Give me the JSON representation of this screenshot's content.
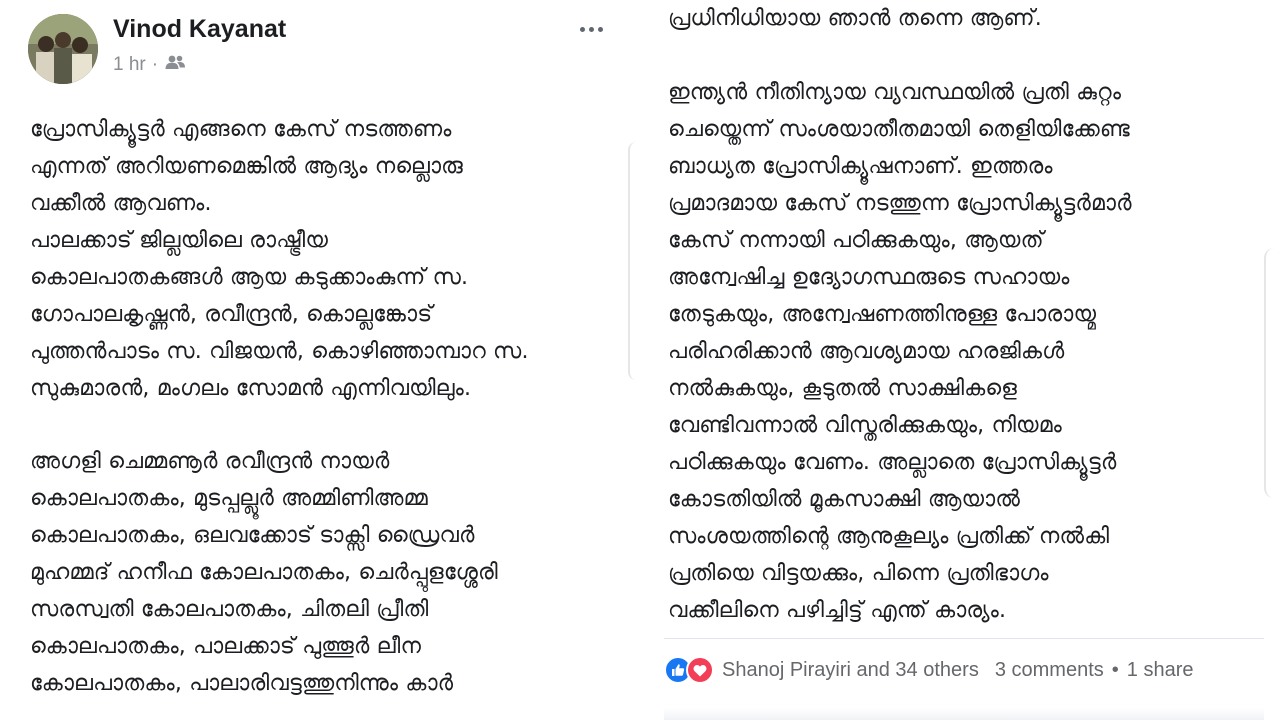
{
  "post": {
    "author": "Vinod Kayanat",
    "timestamp": "1 hr",
    "audience_icon": "friends-icon"
  },
  "left": {
    "para1": "പ്രോസിക്യൂട്ടർ എങ്ങനെ കേസ് നടത്തണം\nഎന്നത് അറിയണമെങ്കിൽ ആദ്യം നല്ലൊരു\nവക്കീൽ ആവണം.\nപാലക്കാട് ജില്ലയിലെ  രാഷ്ട്രീയ\nകൊലപാതകങ്ങൾ ആയ കടുക്കാംകുന്ന് സ.\nഗോപാലകൃഷ്ണൻ, രവീന്ദ്രൻ, കൊല്ലങ്കോട്\nപുത്തൻപാടം സ. വിജയൻ, കൊഴിഞ്ഞാമ്പാറ സ.\nസുകുമാരൻ, മംഗലം സോമൻ എന്നിവയിലും.",
    "para2": "അഗളി  ചെമ്മണൂർ രവീന്ദ്രൻ നായർ\nകൊലപാതകം,  മുടപ്പല്ലൂർ അമ്മിണിഅമ്മ\nകൊലപാതകം, ഒലവക്കോട് ടാക്സി ഡ്രൈവർ\nമുഹമ്മദ് ഹനീഫ കോലപാതകം,  ചെർപ്പുളശ്ശേരി\nസരസ്വതി കോലപാതകം,  ചിതലി പ്രീതി\nകൊലപാതകം, പാലക്കാട് പുത്തൂർ ലീന\nകോലപാതകം, പാലാരിവട്ടത്തുനിന്നും കാർ"
  },
  "right": {
    "para3": "പ്രധിനിധിയായ ഞാൻ തന്നെ ആണ്.",
    "para4": "ഇന്ത്യൻ നീതിന്യായ വ്യവസ്ഥയിൽ പ്രതി കുറ്റം\nചെയ്തെന്ന് സംശയാതീതമായി തെളിയിക്കേണ്ട\nബാധ്യത പ്രോസിക്യൂഷനാണ്. ഇത്തരം\nപ്രമാദമായ കേസ് നടത്തുന്ന പ്രോസിക്യൂട്ടർമാർ\nകേസ് നന്നായി പഠിക്കുകയും,  ആയത്\nഅന്വേഷിച്ച ഉദ്യോഗസ്ഥരുടെ സഹായം\nതേടുകയും, അന്വേഷണത്തിനുള്ള പോരായ്മ\nപരിഹരിക്കാൻ ആവശ്യമായ ഹരജികൾ\nനൽകുകയും, കൂടുതൽ സാക്ഷികളെ\nവേണ്ടിവന്നാൽ  വിസ്തരിക്കുകയും, നിയമം\nപഠിക്കുകയും വേണം. അല്ലാതെ പ്രോസിക്യൂട്ടർ\nകോടതിയിൽ മൂകസാക്ഷി ആയാൽ\nസംശയത്തിന്റെ ആനുകൂല്യം പ്രതിക്ക് നൽകി\nപ്രതിയെ വിട്ടയക്കും, പിന്നെ പ്രതിഭാഗം\nവക്കീലിനെ പഴിച്ചിട്ട് എന്ത് കാര്യം."
  },
  "footer": {
    "reactors": "Shanoj Pirayiri and 34 others",
    "comments": "3 comments",
    "dot": "•",
    "shares": "1 share",
    "reaction_icons": [
      "like-icon",
      "love-icon"
    ]
  }
}
